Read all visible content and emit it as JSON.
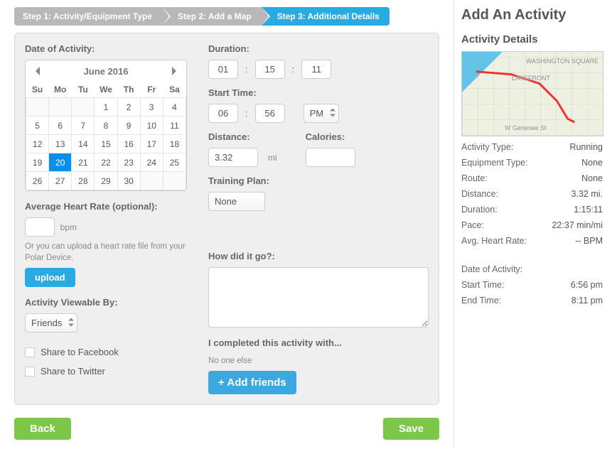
{
  "stepper": {
    "steps": [
      {
        "label": "Step 1: Activity/Equipment Type",
        "active": false
      },
      {
        "label": "Step 2: Add a Map",
        "active": false
      },
      {
        "label": "Step 3: Additional Details",
        "active": true
      }
    ]
  },
  "date_section": {
    "heading": "Date of Activity:",
    "month_label": "June 2016",
    "dow": [
      "Su",
      "Mo",
      "Tu",
      "We",
      "Th",
      "Fr",
      "Sa"
    ],
    "grid": [
      [
        "",
        "",
        "",
        1,
        2,
        3,
        4
      ],
      [
        5,
        6,
        7,
        8,
        9,
        10,
        11
      ],
      [
        12,
        13,
        14,
        15,
        16,
        17,
        18
      ],
      [
        19,
        20,
        21,
        22,
        23,
        24,
        25
      ],
      [
        26,
        27,
        28,
        29,
        30,
        "",
        ""
      ]
    ],
    "selected_day": 20
  },
  "hr_section": {
    "heading": "Average Heart Rate (optional):",
    "value": "",
    "unit": "bpm",
    "hint": "Or you can upload a heart rate file from your Polar Device.",
    "upload_label": "upload"
  },
  "visibility": {
    "heading": "Activity Viewable By:",
    "selected": "Friends",
    "share_fb": "Share to Facebook",
    "share_tw": "Share to Twitter"
  },
  "duration": {
    "heading": "Duration:",
    "hh": "01",
    "mm": "15",
    "ss": "11"
  },
  "start_time": {
    "heading": "Start Time:",
    "hh": "06",
    "mm": "56",
    "ampm": "PM"
  },
  "distance": {
    "heading": "Distance:",
    "value": "3.32",
    "unit": "mi"
  },
  "calories": {
    "heading": "Calories:",
    "value": ""
  },
  "training_plan": {
    "heading": "Training Plan:",
    "selected": "None"
  },
  "notes": {
    "heading": "How did it go?:",
    "value": ""
  },
  "friends": {
    "heading": "I completed this activity with...",
    "sub": "No one else",
    "btn": "+ Add friends"
  },
  "footer": {
    "back": "Back",
    "save": "Save"
  },
  "sidebar": {
    "title": "Add An Activity",
    "subtitle": "Activity Details",
    "map_labels": {
      "a": "WASHINGTON SQUARE",
      "b": "LAKEFRONT",
      "c": "W Genesee St"
    },
    "rows": {
      "activity_type_k": "Activity Type:",
      "activity_type_v": "Running",
      "equipment_k": "Equipment Type:",
      "equipment_v": "None",
      "route_k": "Route:",
      "route_v": "None",
      "distance_k": "Distance:",
      "distance_v": "3.32 mi.",
      "duration_k": "Duration:",
      "duration_v": "1:15:11",
      "pace_k": "Pace:",
      "pace_v": "22:37 min/mi",
      "hr_k": "Avg. Heart Rate:",
      "hr_v": "-- BPM",
      "doa_k": "Date of Activity:",
      "start_k": "Start Time:",
      "start_v": "6:56 pm",
      "end_k": "End Time:",
      "end_v": "8:11 pm"
    }
  }
}
